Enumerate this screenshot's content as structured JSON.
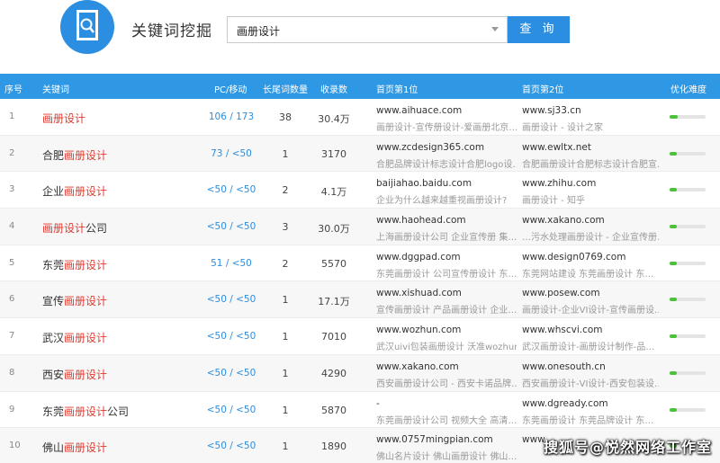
{
  "header": {
    "title": "关键词挖掘",
    "search_value": "画册设计",
    "search_button": "查 询",
    "colors": {
      "brand": "#2b8ee0",
      "highlight": "#e03a2f",
      "difficulty": "#4cc23a"
    }
  },
  "table": {
    "columns": [
      "序号",
      "关键词",
      "PC/移动",
      "长尾词数量",
      "收录数",
      "首页第1位",
      "首页第2位",
      "优化难度"
    ],
    "rows": [
      {
        "idx": "1",
        "kw_pre": "",
        "kw_hl": "画册设计",
        "kw_post": "",
        "pc": "106 / 173",
        "longtail": "38",
        "volume": "30.4万",
        "url1": "www.aihuace.com",
        "desc1": "画册设计-宣传册设计-爱画册北京…",
        "url2": "www.sj33.cn",
        "desc2": "画册设计 - 设计之家",
        "difficulty": 0.22
      },
      {
        "idx": "2",
        "kw_pre": "合肥",
        "kw_hl": "画册设计",
        "kw_post": "",
        "pc": "73 / <50",
        "longtail": "1",
        "volume": "3170",
        "url1": "www.zcdesign365.com",
        "desc1": "合肥品牌设计标志设计合肥logo设…",
        "url2": "www.ewltx.net",
        "desc2": "合肥画册设计合肥标志设计合肥宣…",
        "difficulty": 0.2
      },
      {
        "idx": "3",
        "kw_pre": "企业",
        "kw_hl": "画册设计",
        "kw_post": "",
        "pc": "<50 / <50",
        "longtail": "2",
        "volume": "4.1万",
        "url1": "baijiahao.baidu.com",
        "desc1": "企业为什么越来越重视画册设计?",
        "url2": "www.zhihu.com",
        "desc2": "画册设计 - 知乎",
        "difficulty": 0.2
      },
      {
        "idx": "4",
        "kw_pre": "",
        "kw_hl": "画册设计",
        "kw_post": "公司",
        "pc": "<50 / <50",
        "longtail": "3",
        "volume": "30.0万",
        "url1": "www.haohead.com",
        "desc1": "上海画册设计公司 企业宣传册 集…",
        "url2": "www.xakano.com",
        "desc2": "…污水处理画册设计 - 企业宣传册…",
        "difficulty": 0.2
      },
      {
        "idx": "5",
        "kw_pre": "东莞",
        "kw_hl": "画册设计",
        "kw_post": "",
        "pc": "51 / <50",
        "longtail": "2",
        "volume": "5570",
        "url1": "www.dggpad.com",
        "desc1": "东莞画册设计 公司宣传册设计 东…",
        "url2": "www.design0769.com",
        "desc2": "东莞网站建设 东莞画册设计 东…",
        "difficulty": 0.2
      },
      {
        "idx": "6",
        "kw_pre": "宣传",
        "kw_hl": "画册设计",
        "kw_post": "",
        "pc": "<50 / <50",
        "longtail": "1",
        "volume": "17.1万",
        "url1": "www.xishuad.com",
        "desc1": "宣传画册设计 产品画册设计 企业…",
        "url2": "www.posew.com",
        "desc2": "画册设计-企业VI设计-宣传画册设…",
        "difficulty": 0.2
      },
      {
        "idx": "7",
        "kw_pre": "武汉",
        "kw_hl": "画册设计",
        "kw_post": "",
        "pc": "<50 / <50",
        "longtail": "1",
        "volume": "7010",
        "url1": "www.wozhun.com",
        "desc1": "武汉uivi包装画册设计 沃准wozhun",
        "url2": "www.whscvi.com",
        "desc2": "武汉画册设计-画册设计制作-品…",
        "difficulty": 0.2
      },
      {
        "idx": "8",
        "kw_pre": "西安",
        "kw_hl": "画册设计",
        "kw_post": "",
        "pc": "<50 / <50",
        "longtail": "1",
        "volume": "4290",
        "url1": "www.xakano.com",
        "desc1": "西安画册设计公司 - 西安卡诺品牌…",
        "url2": "www.onesouth.cn",
        "desc2": "西安画册设计-VI设计-西安包装设…",
        "difficulty": 0.2
      },
      {
        "idx": "9",
        "kw_pre": "东莞",
        "kw_hl": "画册设计",
        "kw_post": "公司",
        "pc": "<50 / <50",
        "longtail": "1",
        "volume": "5870",
        "url1": "-",
        "desc1": "东莞画册设计公司 视频大全 高清…",
        "url2": "www.dgready.com",
        "desc2": "东莞画册设计 东莞品牌设计 东…",
        "difficulty": 0.2
      },
      {
        "idx": "10",
        "kw_pre": "佛山",
        "kw_hl": "画册设计",
        "kw_post": "",
        "pc": "<50 / <50",
        "longtail": "1",
        "volume": "1890",
        "url1": "www.0757mingpian.com",
        "desc1": "佛山名片设计 佛山画册设计 佛山…",
        "url2": "www.",
        "desc2": "",
        "difficulty": 0.2
      }
    ]
  },
  "watermark": "搜狐号@悦然网络工作室"
}
